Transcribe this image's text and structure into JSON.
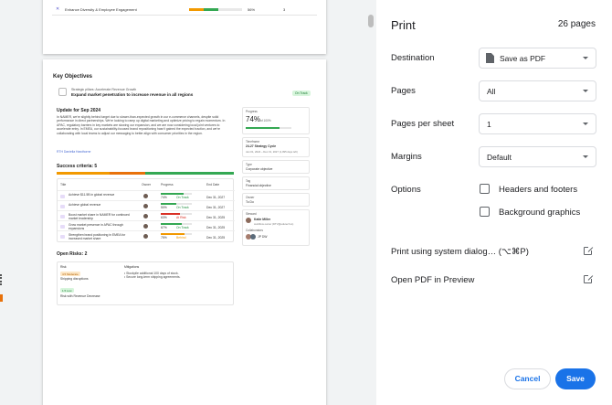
{
  "print": {
    "title": "Print",
    "page_count": "26 pages",
    "destination_label": "Destination",
    "destination_value": "Save as PDF",
    "pages_label": "Pages",
    "pages_value": "All",
    "pages_per_sheet_label": "Pages per sheet",
    "pages_per_sheet_value": "1",
    "margins_label": "Margins",
    "margins_value": "Default",
    "options_label": "Options",
    "headers_footers_label": "Headers and footers",
    "background_graphics_label": "Background graphics",
    "system_dialog_link": "Print using system dialog… (⌥⌘P)",
    "open_pdf_link": "Open PDF in Preview",
    "cancel_label": "Cancel",
    "save_label": "Save"
  },
  "preview": {
    "page1_row": {
      "text": "Enhance Diversity & Employee Engagement",
      "percent": "56%",
      "count": "3"
    },
    "key_objectives": "Key Objectives",
    "pillar_small": "Strategic pillars: Accelerate Revenue Growth",
    "pillar_title": "Expand market penetration to increase revenue in all regions",
    "on_track": "On Track",
    "update_heading": "Update for Sep 2024",
    "update_text": "In NAMER, we're slightly behind target due to slower-than-expected growth in our e-commerce channels, despite solid performance in direct partnerships. We're looking to ramp up digital marketing and optimize pricing to regain momentum. In APAC, regulatory barriers in key markets are slowing our expansion, and we are now considering local joint ventures to accelerate entry. In EMEA, our sustainability-focused brand repositioning hasn't gained the expected traction, and we're collaborating with local teams to adjust our messaging to better align with consumer priorities in the region.",
    "update_author": "RTH Daniella Hawthorne",
    "success_heading": "Success criteria: 5",
    "table_headers": [
      "Title",
      "Owner",
      "Progress",
      "End Date"
    ],
    "rows": [
      {
        "title": "Achieve $11.5B in global revenue",
        "progress": "74%",
        "status": "On Track",
        "date": "Dec 31, 2027"
      },
      {
        "title": "Achieve global revenue",
        "progress": "50%",
        "status": "On Track",
        "date": "Dec 31, 2027"
      },
      {
        "title": "Boost market share in NAMER for continued market leadership",
        "progress": "63%",
        "status": "At Risk",
        "date": "Dec 31, 2025"
      },
      {
        "title": "Grow market presence in APAC through expansions",
        "progress": "67%",
        "status": "On Track",
        "date": "Dec 31, 2025"
      },
      {
        "title": "Strengthen brand positioning in EMEA for increased market share",
        "progress": "75%",
        "status": "Behind",
        "date": "Dec 31, 2025"
      }
    ],
    "risks_heading": "Open Risks: 2",
    "risk_headers": [
      "Risk",
      "Mitigations"
    ],
    "risks": [
      {
        "chip": "4.5 Moderate",
        "name": "Shipping disruptions",
        "mitigations": "• Stockpile additional 100 days of stock.\n• Secure long-term shipping agreements."
      },
      {
        "chip": "1.5 Low",
        "name": "Risk with Revenue Decrease",
        "mitigations": ""
      }
    ],
    "side": {
      "progress_label": "Progress",
      "progress_value": "74%",
      "progress_sub": "of 100%",
      "timeframe_label": "Timeframe",
      "timeframe_value": "24-27 Strategy Cycle",
      "timeframe_sub": "Jan 01, 2024 – Dec 31, 2027 (1,095 days left)",
      "type_label": "Type",
      "type_value": "Corporate objective",
      "tag_label": "Tag",
      "tag_value": "Financial objective",
      "owner_label": "Owner",
      "owner_value": "To Do",
      "steward_label": "Steward",
      "steward_name": "Katie Miller",
      "steward_sub": "workflow owner (DTV@edutech.io)",
      "collab_label": "Collaborators",
      "collab_value": "JP DW"
    }
  },
  "colors": {
    "accent": "#1a73e8",
    "on_track": "#1e8e3e",
    "at_risk": "#d93025",
    "behind": "#f29900",
    "progress_green": "#34a853",
    "progress_orange": "#f29900"
  }
}
